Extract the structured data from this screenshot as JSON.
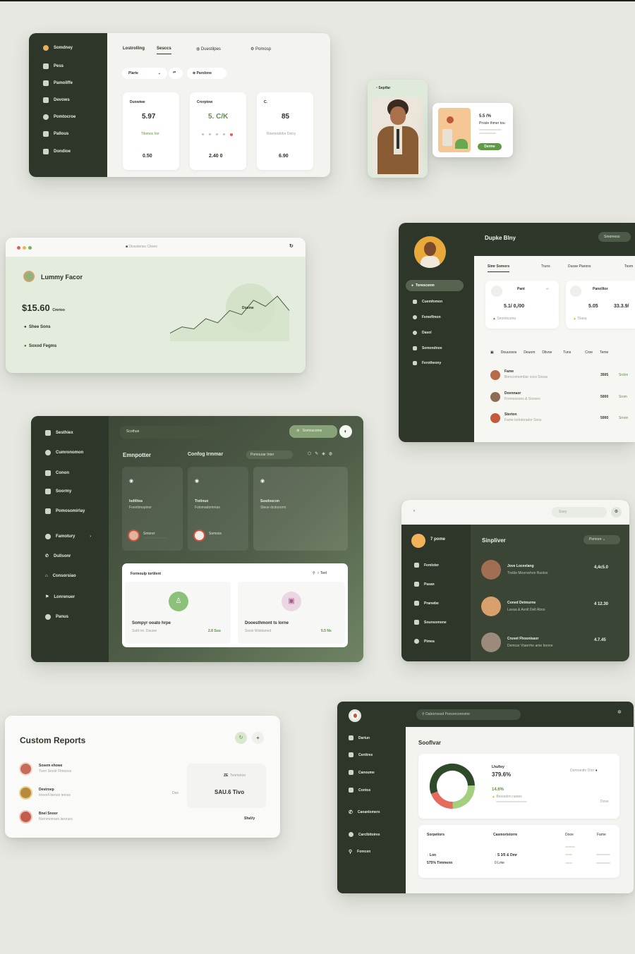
{
  "colors": {
    "background": "#e7e8e2",
    "sidebar": "#2d3629",
    "accent": "#6aa84f",
    "danger": "#e06050"
  },
  "card1": {
    "brand": "Somdney",
    "sidebar": [
      "Pess",
      "Pamoliffe",
      "Devows",
      "Pomtocroe",
      "Pallous",
      "Dondioe"
    ],
    "tabs": [
      "Lostrolling",
      "Sesccs",
      "Duestilpes",
      "Pomosp"
    ],
    "filter": "Plarte",
    "filter_btn": "Parolone",
    "stats": [
      {
        "label": "Duowiwe",
        "value": "5.97",
        "sub": "Tilomoc hor",
        "foot": "0.50"
      },
      {
        "label": "Crorptow",
        "value": "5. C/K",
        "sub": "",
        "foot": "2.40 0"
      },
      {
        "label": "C.",
        "value": "85",
        "sub": "Roemodofor Dorry",
        "foot": "6.90"
      }
    ]
  },
  "profile": {
    "name": "Sepifar"
  },
  "promo": {
    "value": "5.5 /%",
    "text": "Prosle thmer tou",
    "button": "Derme"
  },
  "card2": {
    "url": "Diosstenec Citoee",
    "title": "Lummy Facor",
    "amount": "$15.60",
    "amount_unit": "Cmrioo",
    "items": [
      "Shee Sons",
      "Soxod Fegms"
    ],
    "chart_label": "Dosme",
    "chart_data": {
      "type": "area",
      "values": [
        8,
        14,
        12,
        22,
        18,
        30,
        26,
        40,
        34,
        44,
        30
      ]
    }
  },
  "card3": {
    "title": "Dupke Blny",
    "button": "Smomeso",
    "sidebar": [
      "Toreoconm",
      "Cuemfomon",
      "Femeflmon",
      "Dasol",
      "Semondnoe",
      "Ferotheony"
    ],
    "tabs": [
      "Simr Somors",
      "Truns",
      "Dusse Piarons",
      "Toom"
    ],
    "stat1": {
      "label": "Pant",
      "value": "5.1/ 0,/00",
      "sub": "Snomtcoma"
    },
    "stat2": {
      "label": "Panolltor",
      "value": "5.05",
      "value2": "33.3.9/",
      "sub": "Tilasa"
    },
    "table_head": [
      "Deuuosos",
      "Deuom",
      "Dlivoe",
      "Tuns",
      "Croe",
      "Teme"
    ],
    "rows": [
      {
        "name": "Fame",
        "desc": "Borocomombar cocs Sosas",
        "value": "3505",
        "status": "Srdon"
      },
      {
        "name": "Dovnnaor",
        "desc": "Fromoosons & Sooves",
        "value": "5000",
        "status": "Srom"
      },
      {
        "name": "Sterton",
        "desc": "Fame lortotorador Soos",
        "value": "5000",
        "status": "Sroon"
      }
    ]
  },
  "card4": {
    "sidebar": [
      "Sesthiex",
      "Cumronomon",
      "Conon",
      "Soormy",
      "Pomosomirlay",
      "Famotury",
      "Dullsonr",
      "Consorsiao",
      "Lonrenuer",
      "Panus"
    ],
    "search": "Scothue",
    "top_button": "Somoscome",
    "title": "Emnpotter",
    "subtitle": "Confog Irmmar",
    "filter": "Pomourar Inter",
    "tiles": [
      {
        "title": "Isdtlitea",
        "sub": "Foentimopinor",
        "person": "Smorer"
      },
      {
        "title": "Tistinuo",
        "sub": "Folomadommas",
        "person": "Somoss"
      },
      {
        "title": "Susdoscon",
        "sub": "Sleoe dcdooorm",
        "person": ""
      }
    ],
    "panel_title": "Formoulp tortilent",
    "panel_links": "Teel",
    "panel_items": [
      {
        "title": "Sompyr ooato hrpe",
        "sub": "Sutit mr. Dauwe",
        "value": "2.8 Suu"
      },
      {
        "title": "Dooesthmont ts lorne",
        "sub": "Sosio Wisbianed",
        "value": "5.5 Ns"
      }
    ]
  },
  "card5": {
    "search": "Soey",
    "user": "7 pome",
    "sidebar": [
      "Femloter",
      "Pasan",
      "Pranwbe",
      "Sounsomone",
      "Pimea"
    ],
    "title": "Sinpliver",
    "button": "Pomore",
    "rows": [
      {
        "name": "Jove Loceelang",
        "sub": "Trolde Moorvehon Ruolos",
        "value": "4,4c5.0"
      },
      {
        "name": "Coned Detmurne",
        "sub": "Lavaa & Avolt Delt Aboo",
        "value": "4 12.30"
      },
      {
        "name": "Cruvet Fhoonisaor",
        "sub": "Demcar Vtaerrhe ame boone",
        "value": "4.7.45"
      }
    ]
  },
  "card6": {
    "title": "Custom Reports",
    "people": [
      {
        "name": "Sosem ehowe",
        "sub": "Tvnn Sroolr Flmsoos"
      },
      {
        "name": "Destroep",
        "sub": "Imoorli benoir lemos"
      },
      {
        "name": "Bnel Snoor",
        "sub": "Nornmomaro laroruro"
      }
    ],
    "side_label": "Dee",
    "right_small": "Tenmoton",
    "right_prefix": "ZE",
    "right_value": "SAU.6 Tivo",
    "right_foot": "ShaVy"
  },
  "card7": {
    "search": "Daborrosod Poncercornome",
    "sidebar": [
      "Dartun",
      "Centtres",
      "Canoume",
      "Contos",
      "Cananlomers",
      "Carclbitoires",
      "Fomcen"
    ],
    "title": "Sooflvar",
    "donut_label": "Lhufiey",
    "donut_value": "379.6%",
    "green_value": "14.6%",
    "green_sub": "Beresdon nanes",
    "right_text": "Dormanttn Dorr",
    "right_foot": "Dove",
    "table_head": [
      "Sorpeitors",
      "Casmoristorre",
      "Dooe",
      "Fame"
    ],
    "row1": [
      "Lon",
      "S 3/5 & Dmr"
    ],
    "row2": [
      "575% Timmenn",
      "0 Lme"
    ],
    "chart_data": {
      "type": "pie",
      "values": [
        55,
        25,
        20
      ],
      "colors": [
        "#2f4a2a",
        "#a4cf7f",
        "#e56b5c"
      ]
    }
  }
}
